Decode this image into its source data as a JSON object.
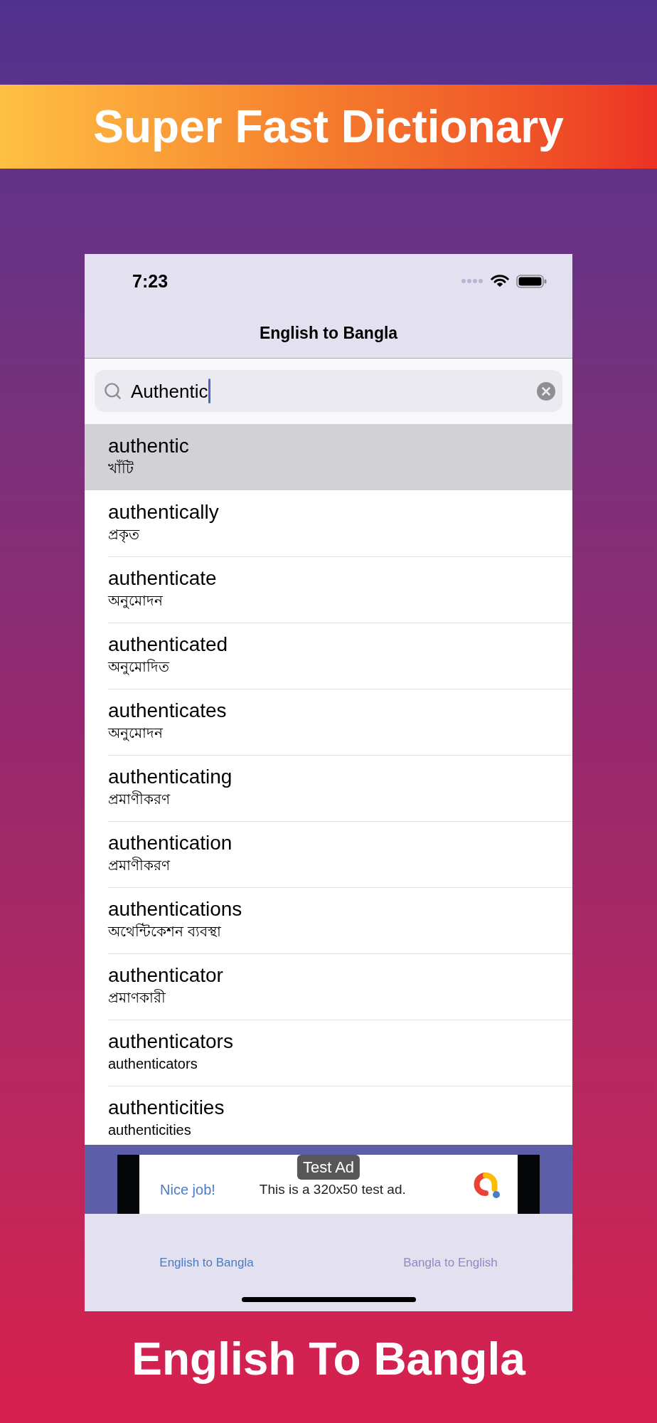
{
  "banner": {
    "title": "Super Fast Dictionary"
  },
  "status_bar": {
    "time": "7:23"
  },
  "nav_bar": {
    "title": "English to Bangla"
  },
  "search": {
    "value": "Authentic"
  },
  "results": [
    {
      "word": "authentic",
      "meaning": "খাঁটি",
      "selected": true
    },
    {
      "word": "authentically",
      "meaning": "প্রকৃত",
      "selected": false
    },
    {
      "word": "authenticate",
      "meaning": "অনুমোদন",
      "selected": false
    },
    {
      "word": "authenticated",
      "meaning": "অনুমোদিত",
      "selected": false
    },
    {
      "word": "authenticates",
      "meaning": "অনুমোদন",
      "selected": false
    },
    {
      "word": "authenticating",
      "meaning": "প্রমাণীকরণ",
      "selected": false
    },
    {
      "word": "authentication",
      "meaning": "প্রমাণীকরণ",
      "selected": false
    },
    {
      "word": "authentications",
      "meaning": "অথেন্টিকেশন ব্যবস্থা",
      "selected": false
    },
    {
      "word": "authenticator",
      "meaning": "প্রমাণকারী",
      "selected": false
    },
    {
      "word": "authenticators",
      "meaning": "authenticators",
      "selected": false
    },
    {
      "word": "authenticities",
      "meaning": "authenticities",
      "selected": false
    }
  ],
  "ad": {
    "label": "Test Ad",
    "headline": "Nice job!",
    "text": "This is a 320x50 test ad."
  },
  "tabs": [
    {
      "label": "English to Bangla",
      "selected": true
    },
    {
      "label": "Bangla to English",
      "selected": false
    }
  ],
  "footer": {
    "title": "English To Bangla"
  }
}
